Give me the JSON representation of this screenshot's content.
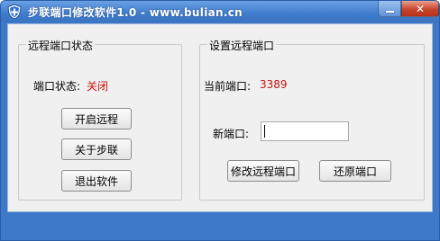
{
  "window": {
    "title": "步联端口修改软件1.0 - www.bulian.cn",
    "icon": "shield-icon",
    "minimize_icon": "minimize-icon",
    "close_icon": "close-icon",
    "close_glyph": "✕"
  },
  "left_group": {
    "title": "远程端口状态",
    "status_label": "端口状态:",
    "status_value": "关闭",
    "buttons": {
      "enable_remote": "开启远程",
      "about": "关于步联",
      "exit": "退出软件"
    }
  },
  "right_group": {
    "title": "设置远程端口",
    "current_port_label": "当前端口:",
    "current_port_value": "3389",
    "new_port_label": "新端口:",
    "new_port_value": "",
    "buttons": {
      "modify_port": "修改远程端口",
      "restore_port": "还原端口"
    }
  },
  "colors": {
    "title_bar": "#3f7ccc",
    "status_red": "#cc1111",
    "close_button": "#c8452d"
  }
}
